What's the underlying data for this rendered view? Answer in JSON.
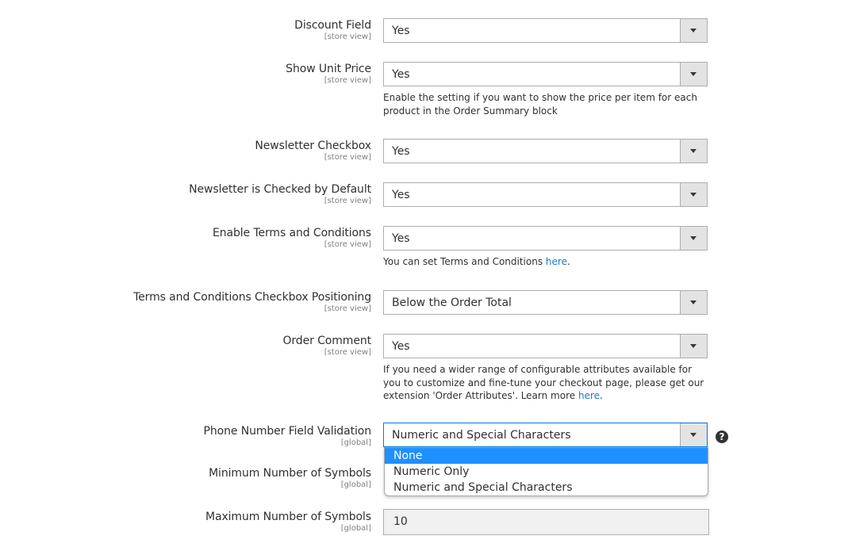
{
  "rows": [
    {
      "label": "Discount Field",
      "scope": "[store view]",
      "value": "Yes"
    },
    {
      "label": "Show Unit Price",
      "scope": "[store view]",
      "value": "Yes",
      "note": "Enable the setting if you want to show the price per item for each product in the Order Summary block"
    },
    {
      "label": "Newsletter Checkbox",
      "scope": "[store view]",
      "value": "Yes"
    },
    {
      "label": "Newsletter is Checked by Default",
      "scope": "[store view]",
      "value": "Yes"
    },
    {
      "label": "Enable Terms and Conditions",
      "scope": "[store view]",
      "value": "Yes",
      "note_prefix": "You can set Terms and Conditions ",
      "note_link": "here",
      "note_suffix": "."
    },
    {
      "label": "Terms and Conditions Checkbox Positioning",
      "scope": "[store view]",
      "value": "Below the Order Total"
    },
    {
      "label": "Order Comment",
      "scope": "[store view]",
      "value": "Yes",
      "note_prefix": "If you need a wider range of configurable attributes available for you to customize and fine-tune your checkout page, please get our extension 'Order Attributes'. Learn more ",
      "note_link": "here",
      "note_suffix": "."
    },
    {
      "label": "Phone Number Field Validation",
      "scope": "[global]",
      "value": "Numeric and Special Characters"
    },
    {
      "label": "Minimum Number of Symbols",
      "scope": "[global]"
    },
    {
      "label": "Maximum Number of Symbols",
      "scope": "[global]",
      "value": "10"
    }
  ],
  "dropdown": {
    "options": [
      "None",
      "Numeric Only",
      "Numeric and Special Characters"
    ],
    "highlighted": "None"
  },
  "help_icon": {
    "glyph": "?"
  },
  "colors": {
    "link": "#1979c3",
    "focus_border": "#007bdb",
    "highlight": "#1e90ff"
  }
}
